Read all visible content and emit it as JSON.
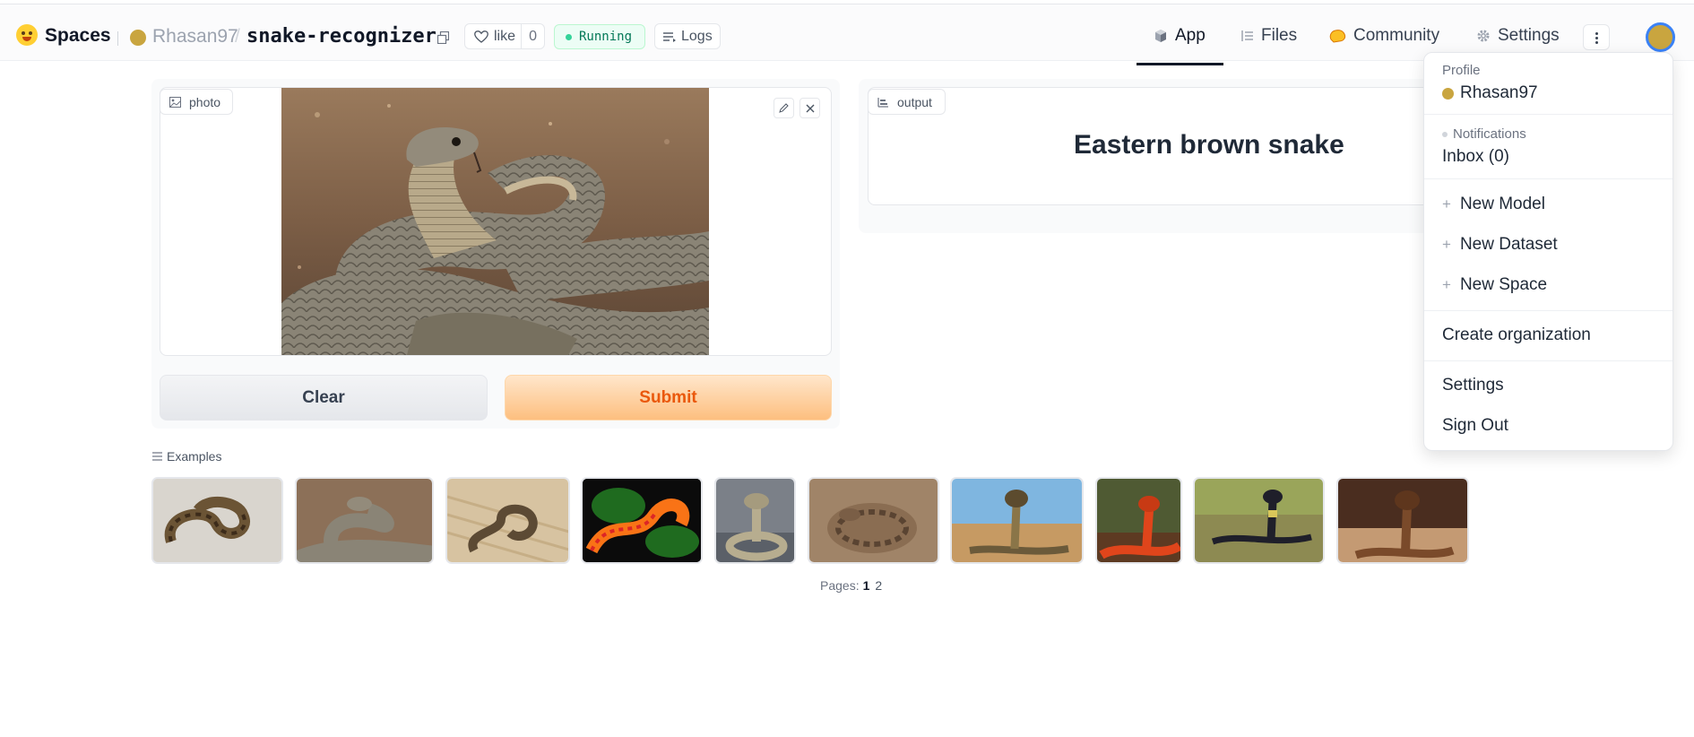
{
  "header": {
    "brand": "Spaces",
    "owner": "Rhasan97",
    "separator": "/",
    "repo": "snake-recognizer",
    "like_label": "like",
    "like_count": "0",
    "status": "Running",
    "logs_label": "Logs",
    "nav": {
      "app": "App",
      "files": "Files",
      "community": "Community",
      "settings": "Settings"
    }
  },
  "input": {
    "label": "photo",
    "clear_label": "Clear",
    "submit_label": "Submit"
  },
  "output": {
    "label": "output",
    "result": "Eastern brown snake"
  },
  "examples": {
    "label": "Examples",
    "pages_label": "Pages:",
    "current_page": "1",
    "other_page": "2"
  },
  "menu": {
    "profile_heading": "Profile",
    "username": "Rhasan97",
    "notifications_heading": "Notifications",
    "inbox": "Inbox (0)",
    "new_model": "New Model",
    "new_dataset": "New Dataset",
    "new_space": "New Space",
    "create_org": "Create organization",
    "settings": "Settings",
    "sign_out": "Sign Out"
  },
  "colors": {
    "accent_orange": "#ea580c",
    "running_green": "#047857",
    "avatar_gold": "#c9a53f"
  }
}
